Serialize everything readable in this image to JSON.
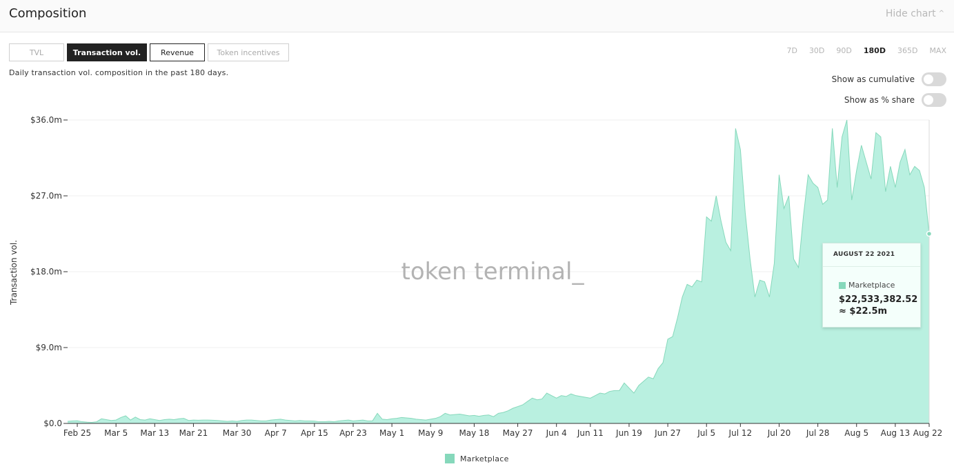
{
  "header": {
    "title": "Composition",
    "hide_chart": "Hide chart"
  },
  "tabs": [
    {
      "label": "TVL",
      "active": false
    },
    {
      "label": "Transaction vol.",
      "active": true
    },
    {
      "label": "Revenue",
      "active": false
    },
    {
      "label": "Token incentives",
      "active": false
    }
  ],
  "description": "Daily transaction vol. composition in the past 180 days.",
  "ranges": [
    {
      "label": "7D",
      "active": false
    },
    {
      "label": "30D",
      "active": false
    },
    {
      "label": "90D",
      "active": false
    },
    {
      "label": "180D",
      "active": true
    },
    {
      "label": "365D",
      "active": false
    },
    {
      "label": "MAX",
      "active": false
    }
  ],
  "toggles": {
    "cumulative": {
      "label": "Show as cumulative",
      "on": false
    },
    "share": {
      "label": "Show as % share",
      "on": false
    }
  },
  "watermark": "token terminal_",
  "tooltip": {
    "date": "AUGUST 22 2021",
    "series": "Marketplace",
    "value": "$22,533,382.52",
    "approx": "≈ $22.5m"
  },
  "legend": {
    "label": "Marketplace"
  },
  "colors": {
    "area_fill": "#b9f0e0",
    "area_line": "#86d8bb",
    "legend_swatch": "#86d8bb"
  },
  "chart_data": {
    "type": "area",
    "ylabel": "Transaction vol.",
    "ylim": [
      0,
      36
    ],
    "y_ticks": [
      "$0.0",
      "$9.0m",
      "$18.0m",
      "$27.0m",
      "$36.0m"
    ],
    "y_tick_values": [
      0,
      9,
      18,
      27,
      36
    ],
    "x_tick_labels": [
      "Feb 25",
      "Mar 5",
      "Mar 13",
      "Mar 21",
      "Mar 30",
      "Apr 7",
      "Apr 15",
      "Apr 23",
      "May 1",
      "May 9",
      "May 18",
      "May 27",
      "Jun 4",
      "Jun 11",
      "Jun 19",
      "Jun 27",
      "Jul 5",
      "Jul 12",
      "Jul 20",
      "Jul 28",
      "Aug 5",
      "Aug 13",
      "Aug 22"
    ],
    "x_tick_days": [
      0,
      8,
      16,
      24,
      33,
      41,
      49,
      57,
      65,
      73,
      82,
      91,
      99,
      106,
      114,
      122,
      130,
      137,
      145,
      153,
      161,
      169,
      178
    ],
    "grid": true,
    "legend_position": "bottom",
    "series": [
      {
        "name": "Marketplace",
        "unit": "$m",
        "start_date": "2021-02-23",
        "end_date": "2021-08-22",
        "values": [
          0.25,
          0.3,
          0.32,
          0.2,
          0.15,
          0.12,
          0.2,
          0.55,
          0.45,
          0.35,
          0.4,
          0.7,
          0.9,
          0.4,
          0.75,
          0.45,
          0.4,
          0.55,
          0.45,
          0.35,
          0.45,
          0.5,
          0.45,
          0.55,
          0.6,
          0.35,
          0.4,
          0.38,
          0.4,
          0.4,
          0.38,
          0.35,
          0.3,
          0.25,
          0.3,
          0.25,
          0.35,
          0.4,
          0.4,
          0.35,
          0.3,
          0.3,
          0.4,
          0.45,
          0.5,
          0.4,
          0.35,
          0.3,
          0.35,
          0.3,
          0.3,
          0.28,
          0.2,
          0.2,
          0.25,
          0.2,
          0.3,
          0.35,
          0.4,
          0.3,
          0.35,
          0.4,
          0.3,
          0.3,
          1.2,
          0.5,
          0.45,
          0.55,
          0.6,
          0.7,
          0.65,
          0.6,
          0.5,
          0.45,
          0.4,
          0.5,
          0.6,
          0.8,
          1.2,
          1.0,
          1.05,
          1.1,
          1.0,
          0.9,
          0.95,
          0.85,
          0.95,
          1.0,
          0.8,
          1.2,
          1.3,
          1.5,
          1.8,
          2.0,
          2.2,
          2.6,
          3.0,
          2.8,
          2.9,
          3.6,
          3.3,
          3.0,
          3.3,
          3.2,
          3.5,
          3.3,
          3.2,
          3.1,
          3.0,
          3.3,
          3.6,
          3.5,
          3.8,
          3.9,
          3.9,
          4.8,
          4.2,
          3.6,
          4.5,
          5.0,
          5.5,
          5.3,
          6.5,
          7.2,
          10.0,
          10.3,
          12.5,
          15.0,
          16.5,
          16.2,
          17.0,
          16.8,
          24.5,
          24.0,
          27.0,
          24.0,
          21.5,
          20.5,
          35.0,
          32.5,
          25.0,
          19.5,
          15.0,
          17.0,
          16.8,
          15.0,
          19.0,
          29.5,
          25.5,
          27.0,
          19.5,
          18.5,
          24.5,
          29.5,
          28.5,
          28.0,
          26.0,
          26.5,
          35.0,
          28.0,
          34.0,
          36.0,
          26.5,
          30.0,
          33.0,
          31.0,
          29.0,
          34.5,
          34.0,
          27.5,
          30.5,
          28.0,
          31.0,
          32.5,
          29.5,
          30.5,
          30.0,
          28.0,
          22.5
        ]
      }
    ]
  }
}
